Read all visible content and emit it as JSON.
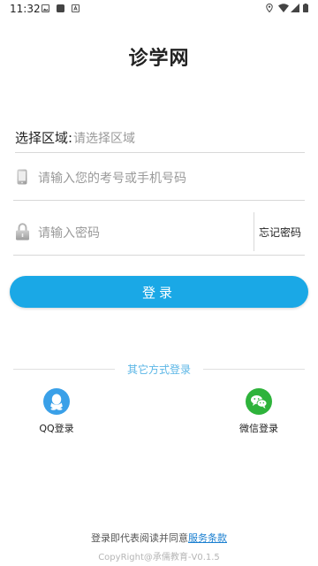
{
  "status_bar": {
    "time": "11:32",
    "left_icons": [
      "image-icon",
      "app-icon",
      "notification-icon"
    ],
    "right_icons": [
      "location-icon",
      "wifi-icon",
      "signal-icon",
      "battery-icon"
    ]
  },
  "app": {
    "title": "诊学网"
  },
  "form": {
    "region_label": "选择区域:",
    "region_placeholder": "请选择区域",
    "account_placeholder": "请输入您的考号或手机号码",
    "password_placeholder": "请输入密码",
    "forgot_label": "忘记密码"
  },
  "actions": {
    "login_label": "登录"
  },
  "other_login": {
    "title": "其它方式登录",
    "qq_label": "QQ登录",
    "wechat_label": "微信登录"
  },
  "footer": {
    "terms_prefix": "登录即代表阅读并同意",
    "terms_link": "服务条款",
    "copyright": "CopyRight@承儒教育-V0.1.5"
  },
  "colors": {
    "accent": "#1aa8e6",
    "qq": "#3aa0e8",
    "wechat": "#2eb33b",
    "link": "#1a7fd0"
  }
}
